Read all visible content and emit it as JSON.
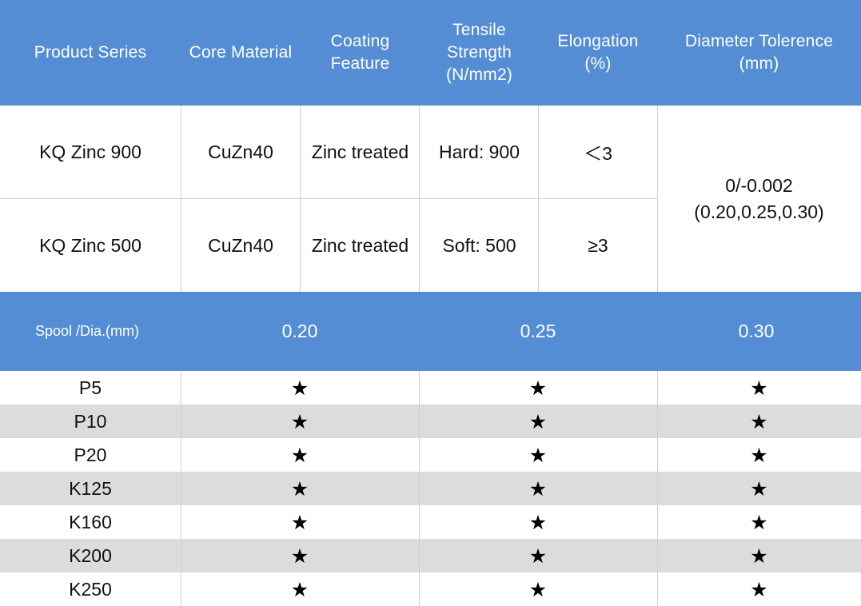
{
  "header": {
    "product_series": "Product Series",
    "core_material": "Core Material",
    "coating_feature": "Coating\nFeature",
    "tensile_strength": "Tensile\nStrength\n(N/mm2)",
    "elongation": "Elongation\n(%)",
    "diameter_tolerence": "Diameter Tolerence\n(mm)"
  },
  "products": [
    {
      "series": "KQ Zinc 900",
      "core": "CuZn40",
      "coating": "Zinc treated",
      "tensile": "Hard: 900",
      "elongation": "＜3"
    },
    {
      "series": "KQ Zinc 500",
      "core": "CuZn40",
      "coating": "Zinc treated",
      "tensile": "Soft: 500",
      "elongation": "≥3"
    }
  ],
  "tolerence": {
    "line1": "0/-0.002",
    "line2": "(0.20,0.25,0.30)"
  },
  "spool_header": {
    "label": "Spool /Dia.(mm)",
    "dia1": "0.20",
    "dia2": "0.25",
    "dia3": "0.30"
  },
  "spools": [
    {
      "name": "P5",
      "c1": "★",
      "c2": "★",
      "c3": "★"
    },
    {
      "name": "P10",
      "c1": "★",
      "c2": "★",
      "c3": "★"
    },
    {
      "name": "P20",
      "c1": "★",
      "c2": "★",
      "c3": "★"
    },
    {
      "name": "K125",
      "c1": "★",
      "c2": "★",
      "c3": "★"
    },
    {
      "name": "K160",
      "c1": "★",
      "c2": "★",
      "c3": "★"
    },
    {
      "name": "K200",
      "c1": "★",
      "c2": "★",
      "c3": "★"
    },
    {
      "name": "K250",
      "c1": "★",
      "c2": "★",
      "c3": "★"
    }
  ],
  "colors": {
    "header_blue": "#548dd4",
    "stripe_gray": "#dcdcdc",
    "grid_line": "#cfcfcf"
  },
  "icons": {
    "availability": "star-icon"
  }
}
